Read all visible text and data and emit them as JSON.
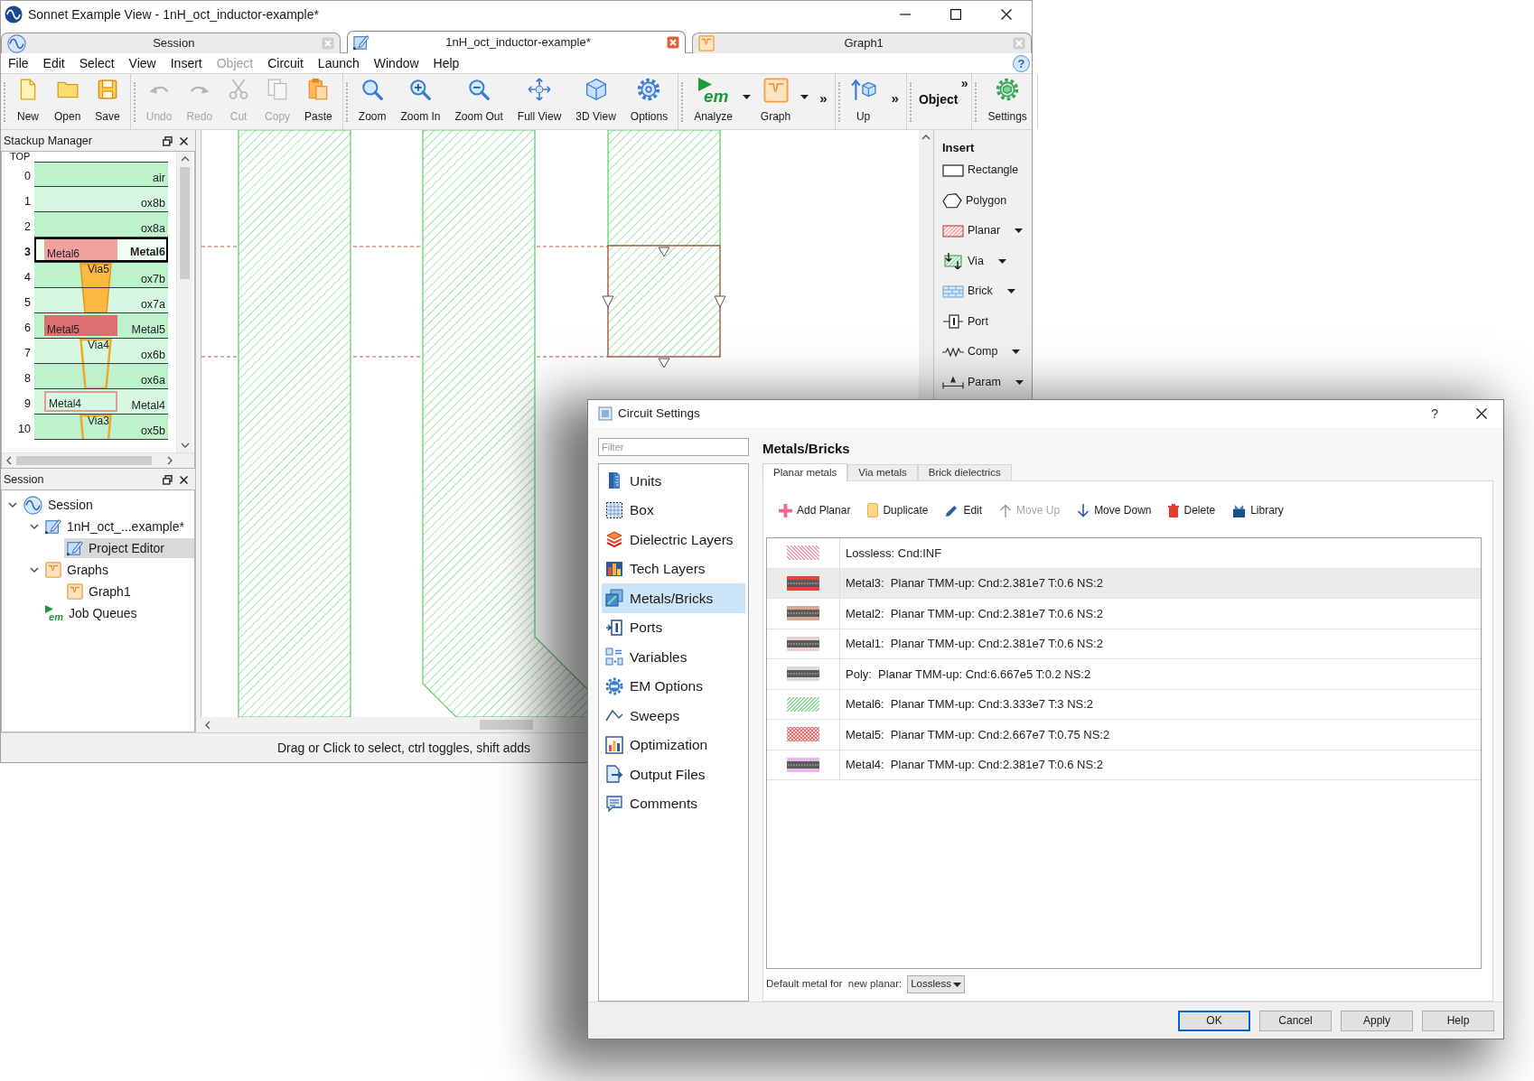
{
  "window": {
    "title": "Sonnet Example View - 1nH_oct_inductor-example*"
  },
  "doc_tabs": [
    {
      "label": "Session",
      "kind": "session",
      "selected": false
    },
    {
      "label": "1nH_oct_inductor-example*",
      "kind": "editor",
      "selected": true
    },
    {
      "label": "Graph1",
      "kind": "graph",
      "selected": false
    }
  ],
  "menu": {
    "items": [
      {
        "label": "File",
        "disabled": false
      },
      {
        "label": "Edit",
        "disabled": false
      },
      {
        "label": "Select",
        "disabled": false
      },
      {
        "label": "View",
        "disabled": false
      },
      {
        "label": "Insert",
        "disabled": false
      },
      {
        "label": "Object",
        "disabled": true
      },
      {
        "label": "Circuit",
        "disabled": false
      },
      {
        "label": "Launch",
        "disabled": false
      },
      {
        "label": "Window",
        "disabled": false
      },
      {
        "label": "Help",
        "disabled": false
      }
    ],
    "help_button": "?"
  },
  "toolbar": {
    "groups": [
      {
        "items": [
          {
            "kind": "new",
            "label": "New",
            "disabled": false,
            "dropdown": false
          },
          {
            "kind": "open",
            "label": "Open",
            "disabled": false,
            "dropdown": false
          },
          {
            "kind": "save",
            "label": "Save",
            "disabled": false,
            "dropdown": false
          }
        ]
      },
      {
        "items": [
          {
            "kind": "undo",
            "label": "Undo",
            "disabled": true,
            "dropdown": false
          },
          {
            "kind": "redo",
            "label": "Redo",
            "disabled": true,
            "dropdown": false
          },
          {
            "kind": "cut",
            "label": "Cut",
            "disabled": true,
            "dropdown": false
          },
          {
            "kind": "copy",
            "label": "Copy",
            "disabled": true,
            "dropdown": false
          },
          {
            "kind": "paste",
            "label": "Paste",
            "disabled": false,
            "dropdown": false
          }
        ]
      },
      {
        "items": [
          {
            "kind": "zoom",
            "label": "Zoom",
            "disabled": false,
            "dropdown": false
          },
          {
            "kind": "zoom_in",
            "label": "Zoom In",
            "disabled": false,
            "dropdown": false
          },
          {
            "kind": "zoom_out",
            "label": "Zoom Out",
            "disabled": false,
            "dropdown": false
          },
          {
            "kind": "full_view",
            "label": "Full View",
            "disabled": false,
            "dropdown": false
          },
          {
            "kind": "view_3d",
            "label": "3D View",
            "disabled": false,
            "dropdown": false
          },
          {
            "kind": "options",
            "label": "Options",
            "disabled": false,
            "dropdown": false
          }
        ]
      },
      {
        "items": [
          {
            "kind": "analyze",
            "label": "Analyze",
            "logo_text": "em",
            "disabled": false,
            "dropdown": true
          },
          {
            "kind": "graph",
            "label": "Graph",
            "disabled": false,
            "dropdown": true
          },
          {
            "kind": "overflow",
            "label": "»"
          }
        ]
      },
      {
        "items": [
          {
            "kind": "up",
            "label": "Up",
            "disabled": false,
            "dropdown": false
          },
          {
            "kind": "overflow",
            "label": "»"
          }
        ]
      },
      {
        "items": [
          {
            "kind": "heading",
            "label": "Object",
            "overflow": "»"
          }
        ]
      },
      {
        "items": [
          {
            "kind": "settings",
            "label": "Settings",
            "disabled": false,
            "dropdown": false
          }
        ]
      }
    ]
  },
  "stackup_manager": {
    "title": "Stackup Manager",
    "top_label": "TOP",
    "layers": [
      {
        "number": "0",
        "label": "air",
        "selected": false
      },
      {
        "number": "1",
        "label": "ox8b",
        "selected": false
      },
      {
        "number": "2",
        "label": "ox8a",
        "selected": false
      },
      {
        "number": "3",
        "label": "Metal6",
        "selected": true,
        "block": {
          "label": "Metal6",
          "kind": "filled",
          "color": "#f2a0a0"
        }
      },
      {
        "number": "4",
        "label": "ox7b",
        "selected": false,
        "via": {
          "label": "Via5",
          "kind": "filled"
        }
      },
      {
        "number": "5",
        "label": "ox7a",
        "selected": false
      },
      {
        "number": "6",
        "label": "Metal5",
        "selected": false,
        "block": {
          "label": "Metal5",
          "kind": "filled",
          "color": "#dc6f6f"
        }
      },
      {
        "number": "7",
        "label": "ox6b",
        "selected": false,
        "via": {
          "label": "Via4",
          "kind": "outline"
        }
      },
      {
        "number": "8",
        "label": "ox6a",
        "selected": false
      },
      {
        "number": "9",
        "label": "Metal4",
        "selected": false,
        "block": {
          "label": "Metal4",
          "kind": "outline",
          "color": "#e39a9a"
        }
      },
      {
        "number": "10",
        "label": "ox5b",
        "selected": false,
        "via": {
          "label": "Via3",
          "kind": "outline"
        }
      }
    ]
  },
  "session_panel": {
    "title": "Session",
    "tree": [
      {
        "label": "Session",
        "kind": "session",
        "expanded": true,
        "selected": false,
        "children": [
          {
            "label": "1nH_oct_...example*",
            "kind": "editor",
            "expanded": true,
            "selected": false,
            "children": [
              {
                "label": "Project Editor",
                "kind": "editor",
                "selected": true
              }
            ]
          },
          {
            "label": "Graphs",
            "kind": "graph",
            "expanded": true,
            "selected": false,
            "children": [
              {
                "label": "Graph1",
                "kind": "graph",
                "selected": false
              }
            ]
          },
          {
            "label": "Job Queues",
            "kind": "jobs",
            "logo_text": "em",
            "selected": false
          }
        ]
      }
    ]
  },
  "insert_panel": {
    "title": "Insert",
    "items": [
      {
        "kind": "rectangle",
        "label": "Rectangle",
        "dropdown": false
      },
      {
        "kind": "polygon",
        "label": "Polygon",
        "dropdown": false
      },
      {
        "kind": "planar",
        "label": "Planar",
        "dropdown": true
      },
      {
        "kind": "via",
        "label": "Via",
        "dropdown": true
      },
      {
        "kind": "brick",
        "label": "Brick",
        "dropdown": true
      },
      {
        "kind": "port",
        "label": "Port",
        "dropdown": false
      },
      {
        "kind": "comp",
        "label": "Comp",
        "dropdown": true
      },
      {
        "kind": "param",
        "label": "Param",
        "dropdown": true
      }
    ]
  },
  "status_bar": {
    "text": "Drag or Click to select, ctrl toggles, shift adds"
  },
  "dialog": {
    "title": "Circuit Settings",
    "help_button": "?",
    "filter": {
      "placeholder": "Filter"
    },
    "nav": [
      {
        "kind": "units",
        "label": "Units",
        "selected": false
      },
      {
        "kind": "box",
        "label": "Box",
        "selected": false
      },
      {
        "kind": "dielectric",
        "label": "Dielectric Layers",
        "selected": false
      },
      {
        "kind": "tech",
        "label": "Tech Layers",
        "selected": false
      },
      {
        "kind": "metals",
        "label": "Metals/Bricks",
        "selected": true
      },
      {
        "kind": "ports",
        "label": "Ports",
        "selected": false
      },
      {
        "kind": "variables",
        "label": "Variables",
        "selected": false
      },
      {
        "kind": "em_options",
        "label": "EM Options",
        "selected": false
      },
      {
        "kind": "sweeps",
        "label": "Sweeps",
        "selected": false
      },
      {
        "kind": "optimization",
        "label": "Optimization",
        "selected": false
      },
      {
        "kind": "output",
        "label": "Output Files",
        "selected": false
      },
      {
        "kind": "comments",
        "label": "Comments",
        "selected": false
      }
    ],
    "heading": "Metals/Bricks",
    "tabs": [
      {
        "label": "Planar metals",
        "selected": true
      },
      {
        "label": "Via metals",
        "selected": false
      },
      {
        "label": "Brick dielectrics",
        "selected": false
      }
    ],
    "actions": [
      {
        "kind": "add",
        "label": "Add Planar",
        "disabled": false
      },
      {
        "kind": "duplicate",
        "label": "Duplicate",
        "disabled": false
      },
      {
        "kind": "edit",
        "label": "Edit",
        "disabled": false
      },
      {
        "kind": "move_up",
        "label": "Move Up",
        "disabled": true
      },
      {
        "kind": "move_down",
        "label": "Move Down",
        "disabled": false
      },
      {
        "kind": "delete",
        "label": "Delete",
        "disabled": false
      },
      {
        "kind": "library",
        "label": "Library",
        "disabled": false
      }
    ],
    "metals": [
      {
        "label": "Lossless: Cnd:INF",
        "kind": "backhatch",
        "color": "#d98aa8",
        "selected": false
      },
      {
        "label": "Metal3:  Planar TMM-up: Cnd:2.381e7 T:0.6 NS:2",
        "kind": "banded",
        "color": "#e8413a",
        "selected": true
      },
      {
        "label": "Metal2:  Planar TMM-up: Cnd:2.381e7 T:0.6 NS:2",
        "kind": "banded",
        "color": "#d8a890",
        "selected": false
      },
      {
        "label": "Metal1:  Planar TMM-up: Cnd:2.381e7 T:0.6 NS:2",
        "kind": "banded",
        "color": "#ecd0d0",
        "selected": false
      },
      {
        "label": "Poly:  Planar TMM-up: Cnd:6.667e5 T:0.2 NS:2",
        "kind": "banded",
        "color": "#dadada",
        "selected": false
      },
      {
        "label": "Metal6:  Planar TMM-up: Cnd:3.333e7 T:3 NS:2",
        "kind": "hatch",
        "color": "#6fcf7f",
        "selected": false
      },
      {
        "label": "Metal5:  Planar TMM-up: Cnd:2.667e7 T:0.75 NS:2",
        "kind": "cross",
        "color": "#e07070",
        "selected": false
      },
      {
        "label": "Metal4:  Planar TMM-up: Cnd:2.381e7 T:0.6 NS:2",
        "kind": "banded",
        "color": "#e8b8ec",
        "selected": false
      }
    ],
    "default_metal": {
      "label": "Default metal for  new planar:",
      "value": "Lossless"
    },
    "buttons": [
      {
        "label": "OK",
        "default": true
      },
      {
        "label": "Cancel",
        "default": false
      },
      {
        "label": "Apply",
        "default": false
      },
      {
        "label": "Help",
        "default": false
      }
    ]
  }
}
